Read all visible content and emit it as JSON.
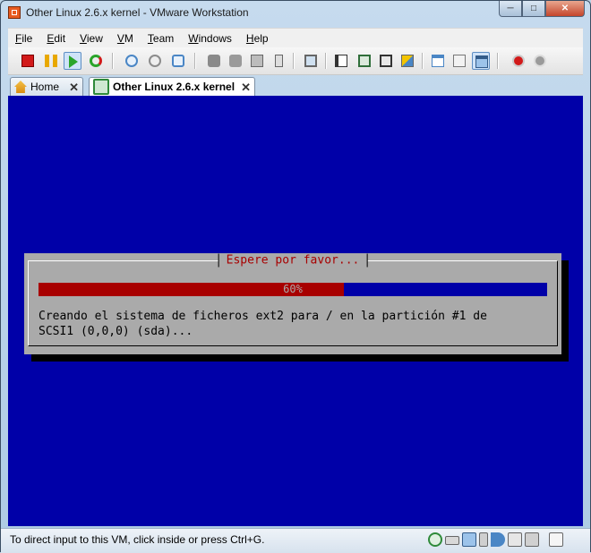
{
  "window": {
    "title": "Other Linux 2.6.x kernel - VMware Workstation"
  },
  "menu": [
    {
      "label": "File",
      "u": "F",
      "rest": "ile"
    },
    {
      "label": "Edit",
      "u": "E",
      "rest": "dit"
    },
    {
      "label": "View",
      "u": "V",
      "rest": "iew"
    },
    {
      "label": "VM",
      "u": "V",
      "rest": "M"
    },
    {
      "label": "Team",
      "u": "T",
      "rest": "eam"
    },
    {
      "label": "Windows",
      "u": "W",
      "rest": "indows"
    },
    {
      "label": "Help",
      "u": "H",
      "rest": "elp"
    }
  ],
  "tabs": {
    "home": "Home",
    "vm": "Other Linux 2.6.x kernel"
  },
  "installer": {
    "dialog_title": "Espere por favor...",
    "progress_percent": 60,
    "progress_label": "60%",
    "message_line1": "Creando el sistema de ficheros ext2 para / en la partición #1 de",
    "message_line2": "SCSI1 (0,0,0) (sda)..."
  },
  "status": {
    "text": "To direct input to this VM, click inside or press Ctrl+G."
  },
  "colors": {
    "vm_background": "#0000a8",
    "dialog_gray": "#aaaaaa",
    "progress_red": "#a80000"
  }
}
